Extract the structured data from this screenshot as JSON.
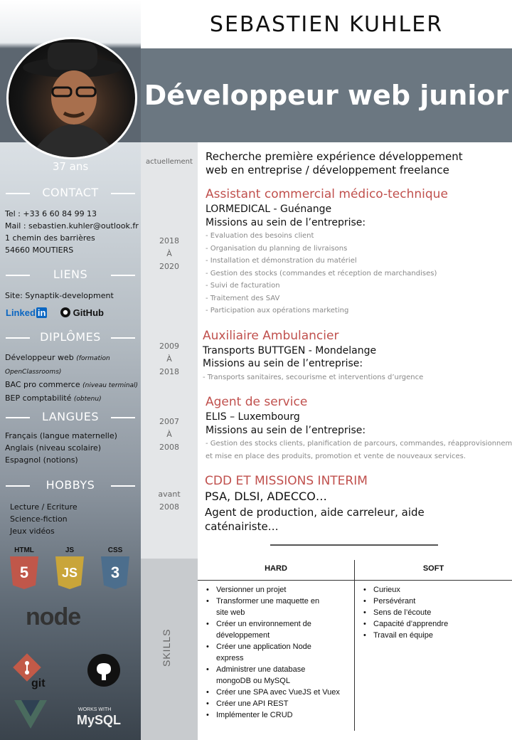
{
  "header": {
    "name": "SEBASTIEN KUHLER",
    "job_title": "Développeur web junior"
  },
  "sidebar": {
    "age": "37 ans",
    "contact": {
      "title": "CONTACT",
      "lines": [
        "Tel : +33 6 60 84 99 13",
        "Mail : sebastien.kuhler@outlook.fr",
        "1 chemin des barrières",
        "54660 MOUTIERS"
      ]
    },
    "liens": {
      "title": "LIENS",
      "site": "Site: Synaptik-development",
      "linkedin_a": "Linked",
      "linkedin_b": "in",
      "github": "GitHub"
    },
    "diplomes": {
      "title": "DIPLÔMES",
      "items": [
        {
          "main": "Développeur web ",
          "note": "(formation"
        },
        {
          "main": "",
          "note": "OpenClassrooms)"
        },
        {
          "main": "BAC pro commerce ",
          "note": "(niveau terminal)"
        },
        {
          "main": "BEP comptabilité ",
          "note": "(obtenu)"
        }
      ]
    },
    "langues": {
      "title": "LANGUES",
      "items": [
        "Français (langue maternelle)",
        "Anglais (niveau scolaire)",
        "Espagnol (notions)"
      ]
    },
    "hobbys": {
      "title": "HOBBYS",
      "items": [
        "Lecture / Ecriture",
        "Science-fiction",
        "Jeux vidéos"
      ]
    },
    "tech": {
      "html": "HTML",
      "html_num": "5",
      "js": "JS",
      "js_letters": "JS",
      "css": "CSS",
      "css_num": "3",
      "node": "node",
      "git": "git",
      "mysql_top": "WORKS WITH",
      "mysql": "MySQL"
    }
  },
  "timeline": {
    "dates": [
      {
        "lines": [
          "actuellement"
        ]
      },
      {
        "lines": [
          "2018",
          "À",
          "2020"
        ]
      },
      {
        "lines": [
          "2009",
          "À",
          "2018"
        ]
      },
      {
        "lines": [
          "2007",
          "À",
          "2008"
        ]
      },
      {
        "lines": [
          "avant",
          "2008"
        ]
      }
    ],
    "skills_label": "SKILLS"
  },
  "entries": {
    "current": [
      "Recherche première expérience développement",
      "web en entreprise / développement freelance"
    ],
    "e1": {
      "title": "Assistant commercial médico-technique",
      "company": "LORMEDICAL - Guénange",
      "missions": "Missions au sein de l’entreprise:",
      "items": [
        "- Evaluation des besoins client",
        "- Organisation du planning de livraisons",
        "- Installation et démonstration du matériel",
        "- Gestion des stocks (commandes et réception de marchandises)",
        "- Suivi de facturation",
        "- Traitement des SAV",
        "- Participation aux opérations marketing"
      ]
    },
    "e2": {
      "title": "Auxiliaire Ambulancier",
      "company": "Transports BUTTGEN - Mondelange",
      "missions": "Missions au sein de l’entreprise:",
      "items": [
        "- Transports sanitaires, secourisme et interventions d’urgence"
      ]
    },
    "e3": {
      "title": "Agent de service",
      "company": "ELIS – Luxembourg",
      "missions": "Missions au sein de l’entreprise:",
      "items": [
        "- Gestion des stocks clients, planification de parcours, commandes, réapprovisionnement",
        "et mise en place des produits, promotion et vente de nouveaux services."
      ]
    },
    "e4": {
      "title": "CDD ET MISSIONS INTERIM",
      "company": "PSA, DLSI, ADECCO…",
      "lines": [
        "Agent de production, aide carreleur, aide",
        "caténairiste…"
      ]
    }
  },
  "skills": {
    "hard_title": "HARD",
    "soft_title": "SOFT",
    "hard": [
      "Versionner un projet",
      "Transformer une maquette en",
      "site web",
      "Créer un environnement de",
      "développement",
      "Créer une application Node",
      "express",
      "Administrer une database",
      "mongoDB ou MySQL",
      "Créer une SPA avec VueJS et Vuex",
      "Créer une API REST",
      "Implémenter le CRUD"
    ],
    "soft": [
      "Curieux",
      "Persévérant",
      "Sens de l’écoute",
      "Capacité d’apprendre",
      "Travail en équipe"
    ]
  }
}
